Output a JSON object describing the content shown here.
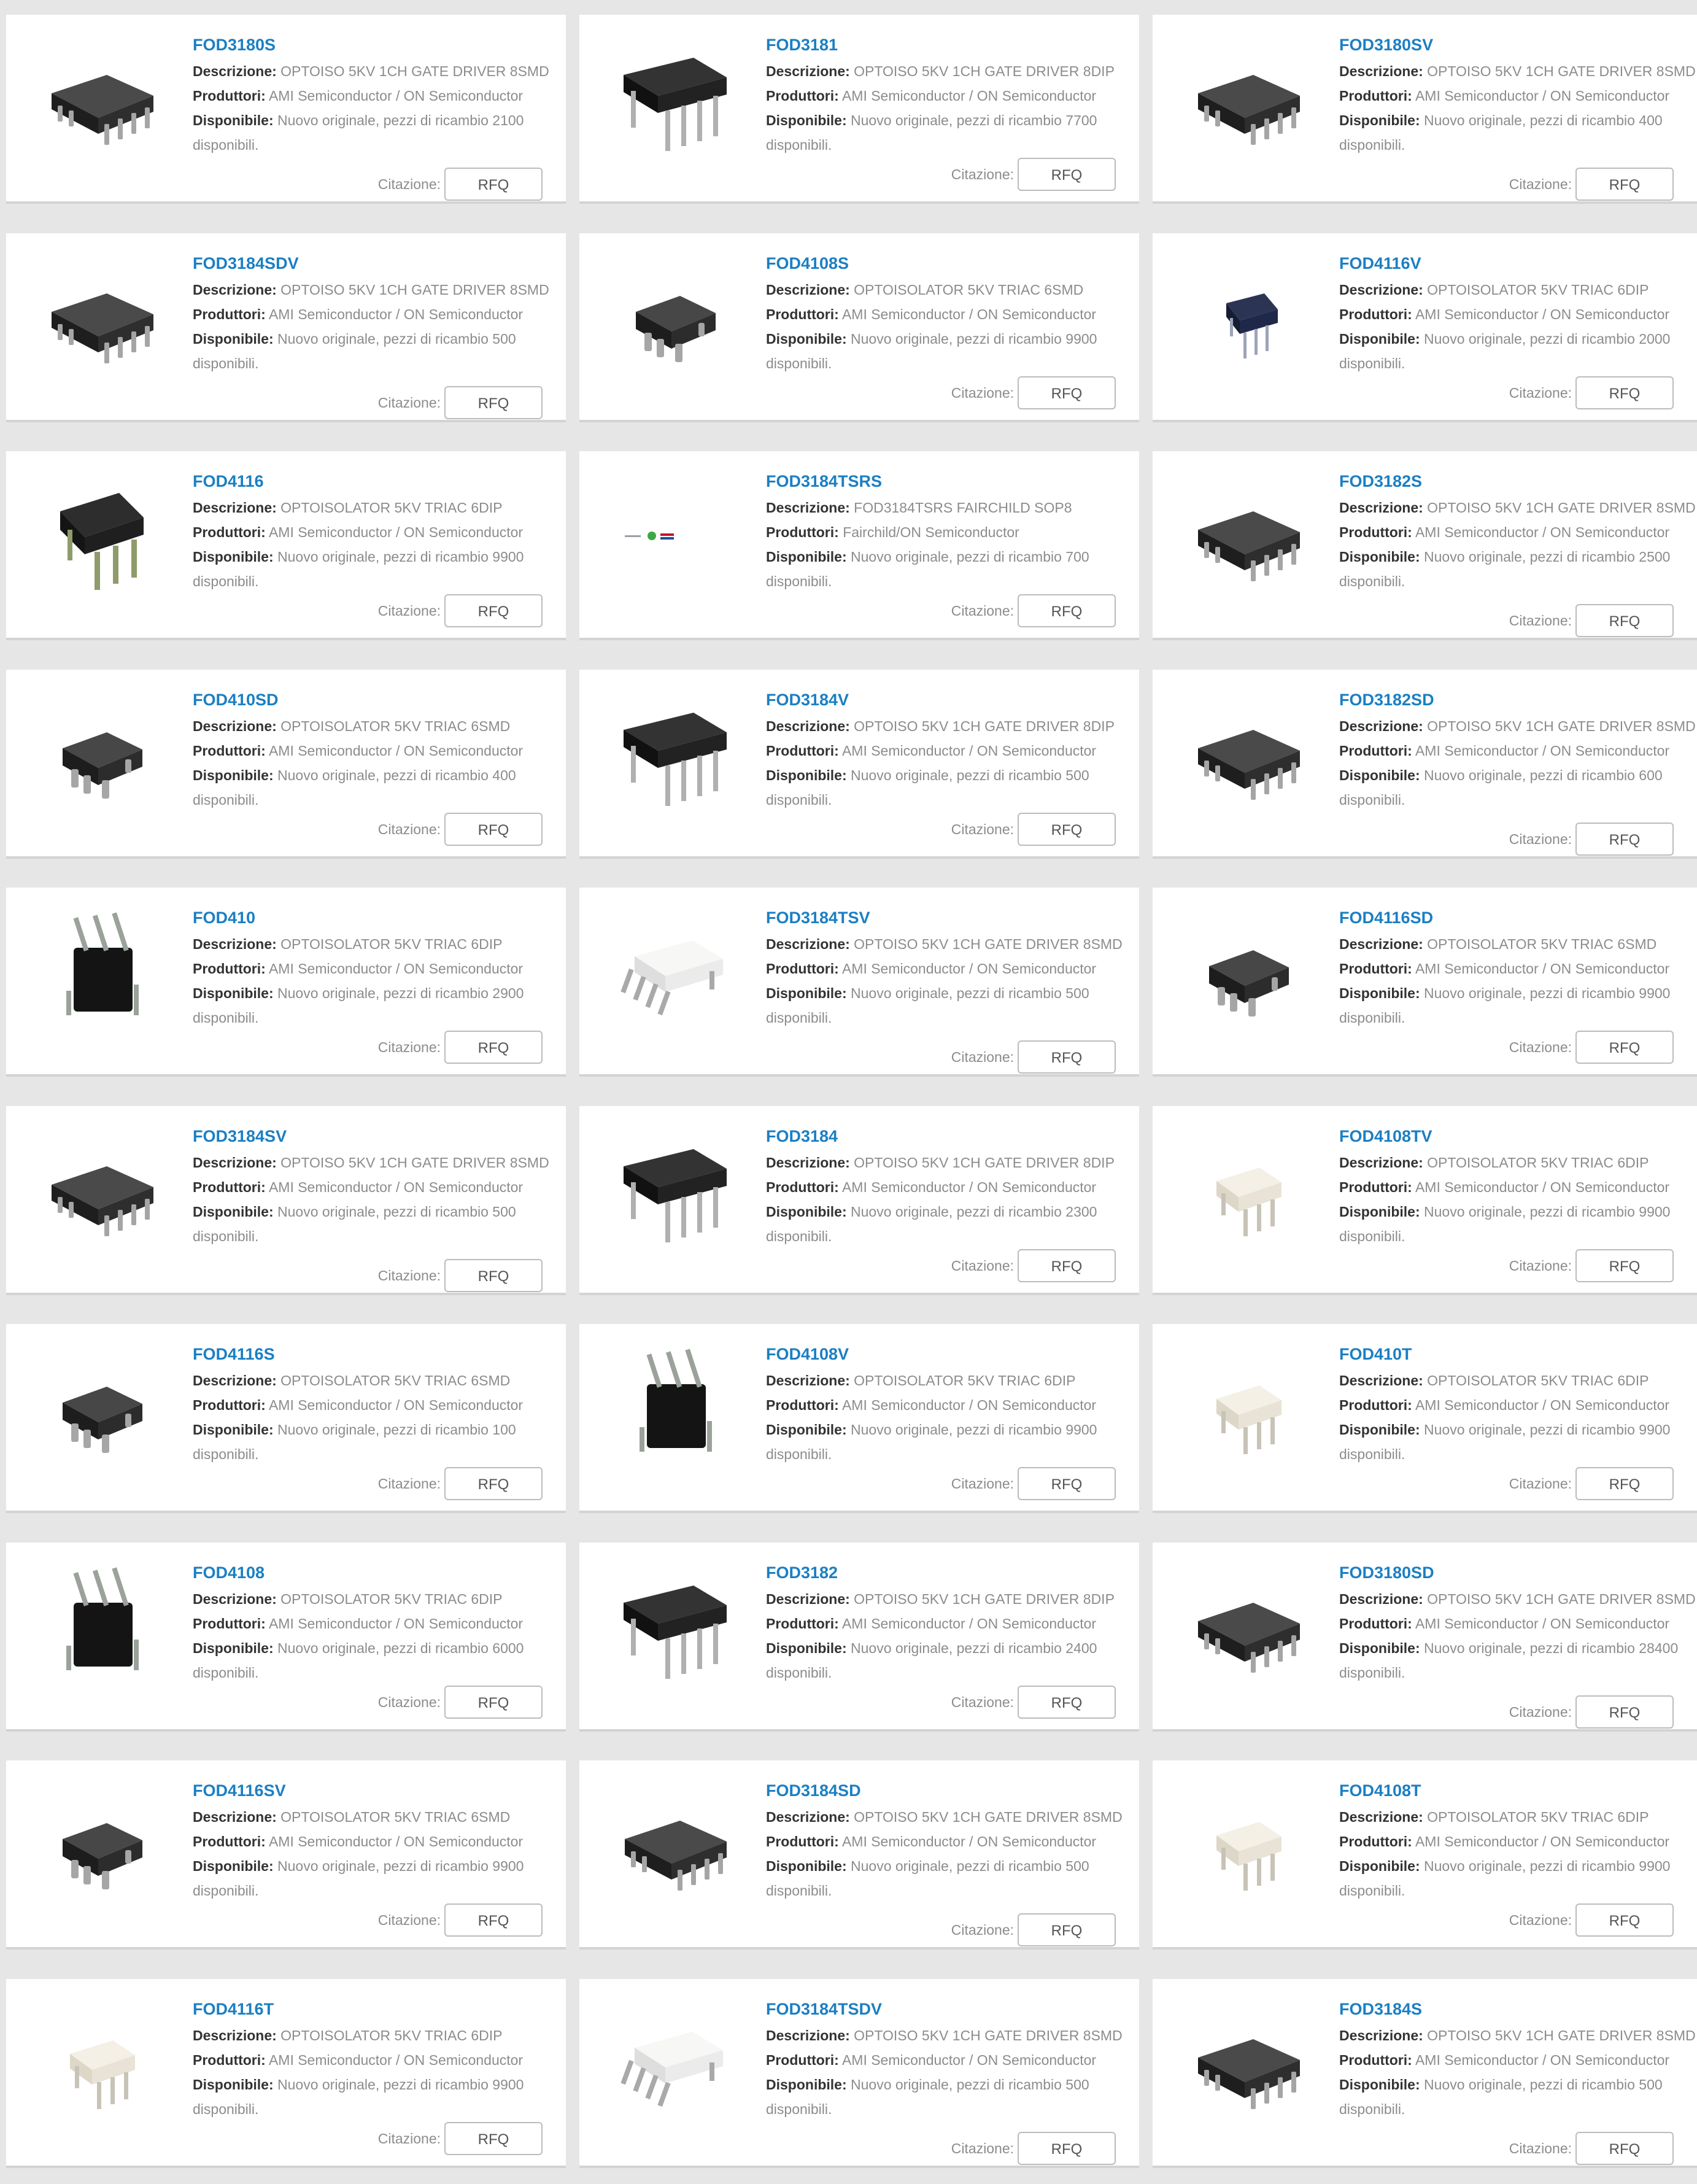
{
  "labels": {
    "description": "Descrizione:",
    "producers": "Produttori:",
    "available": "Disponibile:",
    "quote": "Citazione:",
    "rfq": "RFQ"
  },
  "products": [
    {
      "pn": "FOD3180S",
      "desc": "OPTOISO 5KV 1CH GATE DRIVER 8SMD",
      "prod": "AMI Semiconductor / ON Semiconductor",
      "avail": "Nuovo originale, pezzi di ricambio 2100 disponibili.",
      "img": "smd8-black-icon"
    },
    {
      "pn": "FOD3181",
      "desc": "OPTOISO 5KV 1CH GATE DRIVER 8DIP",
      "prod": "AMI Semiconductor / ON Semiconductor",
      "avail": "Nuovo originale, pezzi di ricambio 7700 disponibili.",
      "img": "dip8-black-icon"
    },
    {
      "pn": "FOD3180SV",
      "desc": "OPTOISO 5KV 1CH GATE DRIVER 8SMD",
      "prod": "AMI Semiconductor / ON Semiconductor",
      "avail": "Nuovo originale, pezzi di ricambio 400 disponibili.",
      "img": "smd8-black-icon"
    },
    {
      "pn": "FOD3184SDV",
      "desc": "OPTOISO 5KV 1CH GATE DRIVER 8SMD",
      "prod": "AMI Semiconductor / ON Semiconductor",
      "avail": "Nuovo originale, pezzi di ricambio 500 disponibili.",
      "img": "smd8-black-icon"
    },
    {
      "pn": "FOD4108S",
      "desc": "OPTOISOLATOR 5KV TRIAC 6SMD",
      "prod": "AMI Semiconductor / ON Semiconductor",
      "avail": "Nuovo originale, pezzi di ricambio 9900 disponibili.",
      "img": "smd6-black-icon"
    },
    {
      "pn": "FOD4116V",
      "desc": "OPTOISOLATOR 5KV TRIAC 6DIP",
      "prod": "AMI Semiconductor / ON Semiconductor",
      "avail": "Nuovo originale, pezzi di ricambio 2000 disponibili.",
      "img": "dip6-navy-icon"
    },
    {
      "pn": "FOD4116",
      "desc": "OPTOISOLATOR 5KV TRIAC 6DIP",
      "prod": "AMI Semiconductor / ON Semiconductor",
      "avail": "Nuovo originale, pezzi di ricambio 9900 disponibili.",
      "img": "dip6-black-icon"
    },
    {
      "pn": "FOD3184TSRS",
      "desc": "FOD3184TSRS FAIRCHILD SOP8",
      "prod": "Fairchild/ON Semiconductor",
      "avail": "Nuovo originale, pezzi di ricambio 700 disponibili.",
      "img": "fairchild-logo-icon"
    },
    {
      "pn": "FOD3182S",
      "desc": "OPTOISO 5KV 1CH GATE DRIVER 8SMD",
      "prod": "AMI Semiconductor / ON Semiconductor",
      "avail": "Nuovo originale, pezzi di ricambio 2500 disponibili.",
      "img": "smd8-black-icon"
    },
    {
      "pn": "FOD410SD",
      "desc": "OPTOISOLATOR 5KV TRIAC 6SMD",
      "prod": "AMI Semiconductor / ON Semiconductor",
      "avail": "Nuovo originale, pezzi di ricambio 400 disponibili.",
      "img": "smd6-black-icon"
    },
    {
      "pn": "FOD3184V",
      "desc": "OPTOISO 5KV 1CH GATE DRIVER 8DIP",
      "prod": "AMI Semiconductor / ON Semiconductor",
      "avail": "Nuovo originale, pezzi di ricambio 500 disponibili.",
      "img": "dip8-black-icon"
    },
    {
      "pn": "FOD3182SD",
      "desc": "OPTOISO 5KV 1CH GATE DRIVER 8SMD",
      "prod": "AMI Semiconductor / ON Semiconductor",
      "avail": "Nuovo originale, pezzi di ricambio 600 disponibili.",
      "img": "smd8-black-icon"
    },
    {
      "pn": "FOD410",
      "desc": "OPTOISOLATOR 5KV TRIAC 6DIP",
      "prod": "AMI Semiconductor / ON Semiconductor",
      "avail": "Nuovo originale, pezzi di ricambio 2900 disponibili.",
      "img": "dip6-front-black-icon"
    },
    {
      "pn": "FOD3184TSV",
      "desc": "OPTOISO 5KV 1CH GATE DRIVER 8SMD",
      "prod": "AMI Semiconductor / ON Semiconductor",
      "avail": "Nuovo originale, pezzi di ricambio 500 disponibili.",
      "img": "smd8-white-icon"
    },
    {
      "pn": "FOD4116SD",
      "desc": "OPTOISOLATOR 5KV TRIAC 6SMD",
      "prod": "AMI Semiconductor / ON Semiconductor",
      "avail": "Nuovo originale, pezzi di ricambio 9900 disponibili.",
      "img": "smd6-black-icon"
    },
    {
      "pn": "FOD3184SV",
      "desc": "OPTOISO 5KV 1CH GATE DRIVER 8SMD",
      "prod": "AMI Semiconductor / ON Semiconductor",
      "avail": "Nuovo originale, pezzi di ricambio 500 disponibili.",
      "img": "smd8-black-icon"
    },
    {
      "pn": "FOD3184",
      "desc": "OPTOISO 5KV 1CH GATE DRIVER 8DIP",
      "prod": "AMI Semiconductor / ON Semiconductor",
      "avail": "Nuovo originale, pezzi di ricambio 2300 disponibili.",
      "img": "dip8-black-icon"
    },
    {
      "pn": "FOD4108TV",
      "desc": "OPTOISOLATOR 5KV TRIAC 6DIP",
      "prod": "AMI Semiconductor / ON Semiconductor",
      "avail": "Nuovo originale, pezzi di ricambio 9900 disponibili.",
      "img": "dip6-white-icon"
    },
    {
      "pn": "FOD4116S",
      "desc": "OPTOISOLATOR 5KV TRIAC 6SMD",
      "prod": "AMI Semiconductor / ON Semiconductor",
      "avail": "Nuovo originale, pezzi di ricambio 100 disponibili.",
      "img": "smd6-black-icon"
    },
    {
      "pn": "FOD4108V",
      "desc": "OPTOISOLATOR 5KV TRIAC 6DIP",
      "prod": "AMI Semiconductor / ON Semiconductor",
      "avail": "Nuovo originale, pezzi di ricambio 9900 disponibili.",
      "img": "dip6-front-black-icon"
    },
    {
      "pn": "FOD410T",
      "desc": "OPTOISOLATOR 5KV TRIAC 6DIP",
      "prod": "AMI Semiconductor / ON Semiconductor",
      "avail": "Nuovo originale, pezzi di ricambio 9900 disponibili.",
      "img": "dip6-white-icon"
    },
    {
      "pn": "FOD4108",
      "desc": "OPTOISOLATOR 5KV TRIAC 6DIP",
      "prod": "AMI Semiconductor / ON Semiconductor",
      "avail": "Nuovo originale, pezzi di ricambio 6000 disponibili.",
      "img": "dip6-front-black-icon"
    },
    {
      "pn": "FOD3182",
      "desc": "OPTOISO 5KV 1CH GATE DRIVER 8DIP",
      "prod": "AMI Semiconductor / ON Semiconductor",
      "avail": "Nuovo originale, pezzi di ricambio 2400 disponibili.",
      "img": "dip8-black-icon"
    },
    {
      "pn": "FOD3180SD",
      "desc": "OPTOISO 5KV 1CH GATE DRIVER 8SMD",
      "prod": "AMI Semiconductor / ON Semiconductor",
      "avail": "Nuovo originale, pezzi di ricambio 28400 disponibili.",
      "img": "smd8-black-icon"
    },
    {
      "pn": "FOD4116SV",
      "desc": "OPTOISOLATOR 5KV TRIAC 6SMD",
      "prod": "AMI Semiconductor / ON Semiconductor",
      "avail": "Nuovo originale, pezzi di ricambio 9900 disponibili.",
      "img": "smd6-black-icon"
    },
    {
      "pn": "FOD3184SD",
      "desc": "OPTOISO 5KV 1CH GATE DRIVER 8SMD",
      "prod": "AMI Semiconductor / ON Semiconductor",
      "avail": "Nuovo originale, pezzi di ricambio 500 disponibili.",
      "img": "smd8-black-icon"
    },
    {
      "pn": "FOD4108T",
      "desc": "OPTOISOLATOR 5KV TRIAC 6DIP",
      "prod": "AMI Semiconductor / ON Semiconductor",
      "avail": "Nuovo originale, pezzi di ricambio 9900 disponibili.",
      "img": "dip6-white-icon"
    },
    {
      "pn": "FOD4116T",
      "desc": "OPTOISOLATOR 5KV TRIAC 6DIP",
      "prod": "AMI Semiconductor / ON Semiconductor",
      "avail": "Nuovo originale, pezzi di ricambio 9900 disponibili.",
      "img": "dip6-white-icon"
    },
    {
      "pn": "FOD3184TSDV",
      "desc": "OPTOISO 5KV 1CH GATE DRIVER 8SMD",
      "prod": "AMI Semiconductor / ON Semiconductor",
      "avail": "Nuovo originale, pezzi di ricambio 500 disponibili.",
      "img": "smd8-white-icon"
    },
    {
      "pn": "FOD3184S",
      "desc": "OPTOISO 5KV 1CH GATE DRIVER 8SMD",
      "prod": "AMI Semiconductor / ON Semiconductor",
      "avail": "Nuovo originale, pezzi di ricambio 500 disponibili.",
      "img": "smd8-black-icon"
    }
  ]
}
